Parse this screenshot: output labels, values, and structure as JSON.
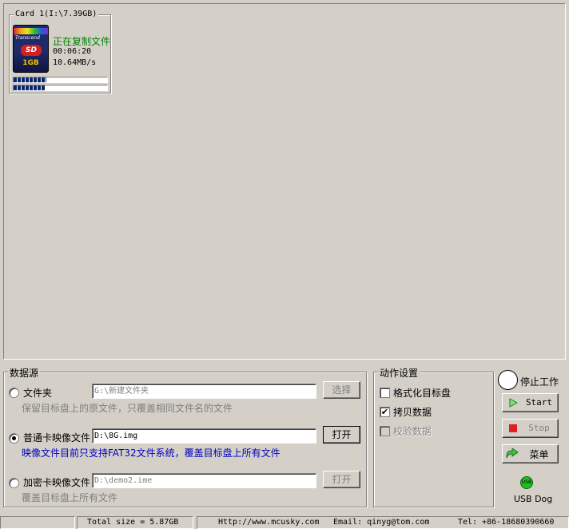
{
  "card": {
    "title": "Card 1(I:\\7.39GB)",
    "icon": {
      "brand": "Transcend",
      "logo": "SD",
      "size": "1GB"
    },
    "status": "正在复制文件",
    "elapsed": "00:06:20",
    "speed": "10.64MB/s",
    "progress_1": 0.35,
    "progress_2": 0.33
  },
  "source": {
    "title": "数据源",
    "folder": {
      "label": "文件夹",
      "path": "G:\\新建文件夹",
      "button": "选择",
      "hint": "保留目标盘上的原文件，只覆盖相同文件名的文件",
      "selected": false
    },
    "normal_image": {
      "label": "普通卡映像文件",
      "path": "D:\\8G.img",
      "button": "打开",
      "hint": "映像文件目前只支持FAT32文件系统，覆盖目标盘上所有文件",
      "selected": true
    },
    "encrypted_image": {
      "label": "加密卡映像文件",
      "path": "D:\\demo2.ime",
      "button": "打开",
      "hint": "覆盖目标盘上所有文件",
      "selected": false
    }
  },
  "actions": {
    "title": "动作设置",
    "format": {
      "label": "格式化目标盘",
      "checked": false
    },
    "copy": {
      "label": "拷贝数据",
      "checked": true
    },
    "verify": {
      "label": "校验数据",
      "checked": false,
      "disabled": true
    }
  },
  "controls": {
    "state_label": "停止工作",
    "start": "Start",
    "stop": "Stop",
    "menu": "菜单",
    "usb_icon_text": "USB",
    "usb_label": "USB Dog"
  },
  "statusbar": {
    "total": "Total size = 5.87GB",
    "website": "Http://www.mcusky.com",
    "email": "Email: qinyg@tom.com",
    "tel": "Tel: +86-18680390660"
  },
  "colors": {
    "status_green": "#008000",
    "hint_blue": "#0000c0",
    "progress": "#0a246a",
    "face": "#d4d0c8"
  }
}
